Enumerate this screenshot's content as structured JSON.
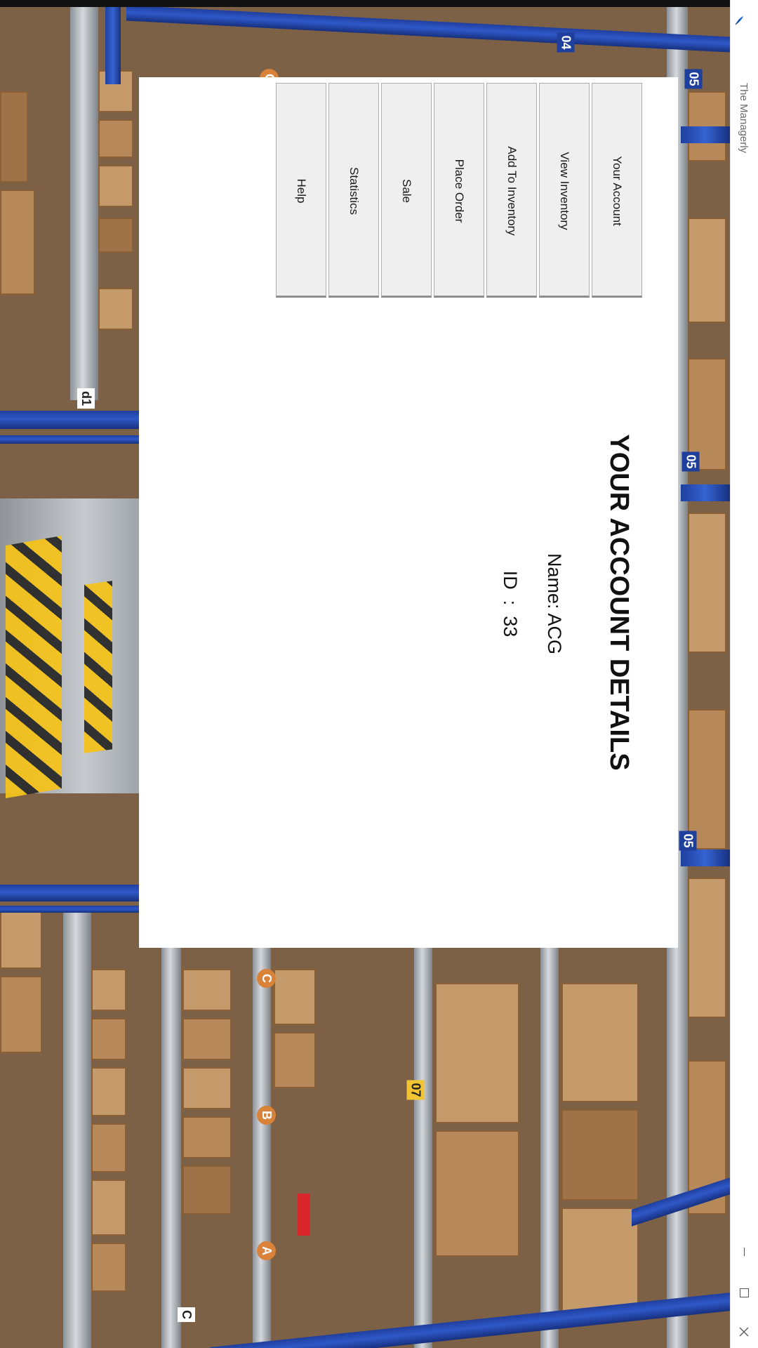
{
  "window": {
    "title": "The Managerly",
    "controls": {
      "minimize": "—",
      "maximize": "☐",
      "close": "✕"
    }
  },
  "menu": {
    "items": [
      {
        "label": "Your Account"
      },
      {
        "label": "View Inventory"
      },
      {
        "label": "Add To Inventory"
      },
      {
        "label": "Place Order"
      },
      {
        "label": "Sale"
      },
      {
        "label": "Statistics"
      },
      {
        "label": "Help"
      }
    ]
  },
  "account": {
    "heading": "YOUR ACCOUNT DETAILS",
    "name_line": "Name: ACG",
    "id_line": "ID  :  33"
  },
  "background": {
    "rack_tags": [
      "04",
      "05",
      "05",
      "05",
      "d1",
      "07",
      "C",
      "C",
      "B",
      "A",
      "C"
    ]
  },
  "colors": {
    "panel": "#ffffff",
    "button": "#efefef",
    "rack_blue": "#2f58c8",
    "accent_icon": "#2a6fd6"
  },
  "icons": {
    "app": "feather-icon",
    "minimize": "minimize-icon",
    "maximize": "maximize-icon",
    "close": "close-icon"
  }
}
